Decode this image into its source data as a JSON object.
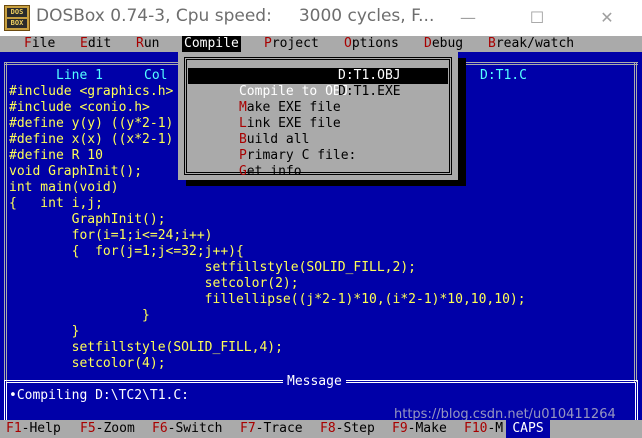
{
  "window": {
    "title": "DOSBox 0.74-3, Cpu speed:     3000 cycles, F...",
    "icon_top": "DOS",
    "icon_bottom": "BOX",
    "controls": {
      "minimize": "—",
      "maximize": "☐",
      "close": "✕"
    }
  },
  "menubar": {
    "items": [
      {
        "hotkey": "F",
        "rest": "ile"
      },
      {
        "hotkey": "E",
        "rest": "dit"
      },
      {
        "hotkey": "R",
        "rest": "un"
      },
      {
        "hotkey": "C",
        "rest": "ompile"
      },
      {
        "hotkey": "P",
        "rest": "roject"
      },
      {
        "hotkey": "O",
        "rest": "ptions"
      },
      {
        "hotkey": "D",
        "rest": "ebug"
      },
      {
        "hotkey": "B",
        "rest": "reak/watch"
      }
    ]
  },
  "editor": {
    "line_label": "Line 1",
    "col_label": "Col",
    "file_label": "D:T1.C",
    "code": [
      "#include <graphics.h>",
      "#include <conio.h>",
      "#define y(y) ((y*2-1)",
      "#define x(x) ((x*2-1)",
      "#define R 10",
      "void GraphInit();",
      "int main(void)",
      "{   int i,j;",
      "        GraphInit();",
      "        for(i=1;i<=24;i++)",
      "        {  for(j=1;j<=32;j++){",
      "                         setfillstyle(SOLID_FILL,2);",
      "                         setcolor(2);",
      "                         fillellipse((j*2-1)*10,(i*2-1)*10,10,10);",
      "                 }",
      "        }",
      "        setfillstyle(SOLID_FILL,4);",
      "        setcolor(4);"
    ]
  },
  "compile_menu": {
    "items": [
      {
        "hotkey": "C",
        "rest": "ompile to OBJ",
        "value": "D:T1.OBJ"
      },
      {
        "hotkey": "M",
        "rest": "ake EXE file",
        "value": "D:T1.EXE"
      },
      {
        "hotkey": "L",
        "rest": "ink EXE file",
        "value": ""
      },
      {
        "hotkey": "B",
        "rest": "uild all",
        "value": ""
      },
      {
        "hotkey": "P",
        "rest": "rimary C file:",
        "value": ""
      },
      {
        "hotkey": "G",
        "rest": "et info",
        "value": ""
      }
    ],
    "selected_index": 0
  },
  "message": {
    "title": "Message",
    "text": "•Compiling D:\\TC2\\T1.C:"
  },
  "fkeys": [
    {
      "key": "F1",
      "label": "-Help"
    },
    {
      "key": "F5",
      "label": "-Zoom"
    },
    {
      "key": "F6",
      "label": "-Switch"
    },
    {
      "key": "F7",
      "label": "-Trace"
    },
    {
      "key": "F8",
      "label": "-Step"
    },
    {
      "key": "F9",
      "label": "-Make"
    },
    {
      "key": "F10",
      "label": "-M"
    }
  ],
  "caps": "CAPS",
  "watermark": "https://blog.csdn.net/u010411264",
  "colors": {
    "dos_blue": "#0000a8",
    "menu_gray": "#aaaaaa",
    "code_yellow": "#ffff55",
    "hotkey_red": "#a80000",
    "status_cyan": "#55ffff"
  }
}
